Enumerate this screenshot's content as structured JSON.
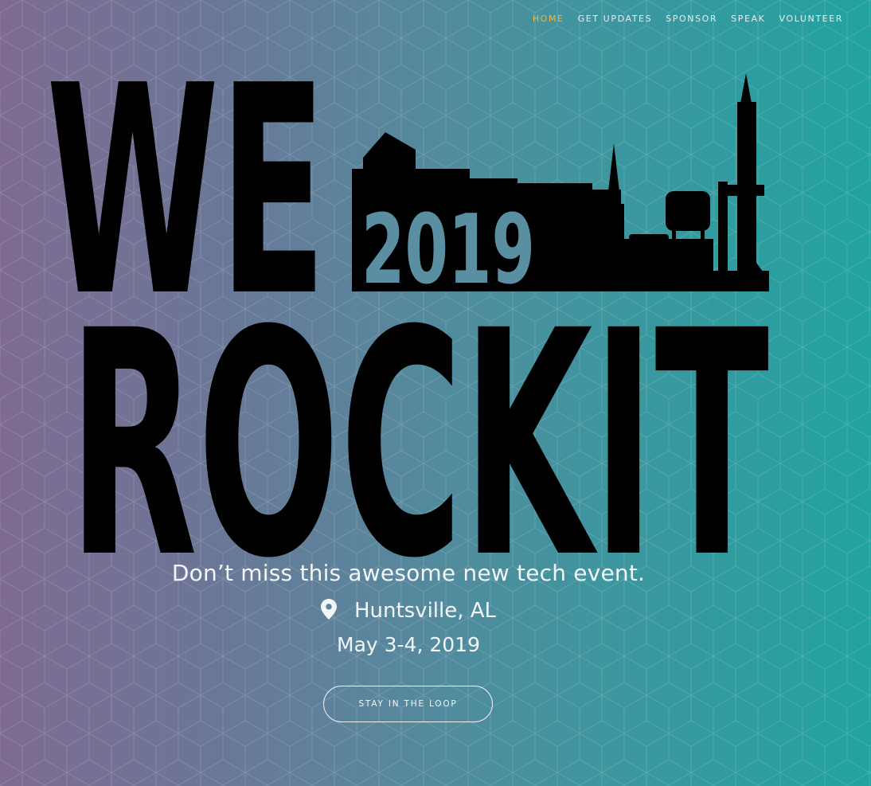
{
  "nav": {
    "items": [
      {
        "label": "HOME",
        "active": true
      },
      {
        "label": "GET UPDATES",
        "active": false
      },
      {
        "label": "SPONSOR",
        "active": false
      },
      {
        "label": "SPEAK",
        "active": false
      },
      {
        "label": "VOLUNTEER",
        "active": false
      }
    ]
  },
  "logo": {
    "line1": "WE",
    "year": "2019",
    "line2": "ROCKIT"
  },
  "hero": {
    "tagline": "Don’t miss this awesome new tech event.",
    "location": "Huntsville, AL",
    "location_icon": "map-pin-icon",
    "date": "May 3-4, 2019",
    "cta_label": "STAY IN THE LOOP"
  },
  "colors": {
    "gradient_left": "#7e6b92",
    "gradient_right": "#22a2a0",
    "nav_active": "#e7bd45",
    "text": "#f2f6f8",
    "logo": "#000000",
    "year_fill": "#5a8ea1"
  }
}
